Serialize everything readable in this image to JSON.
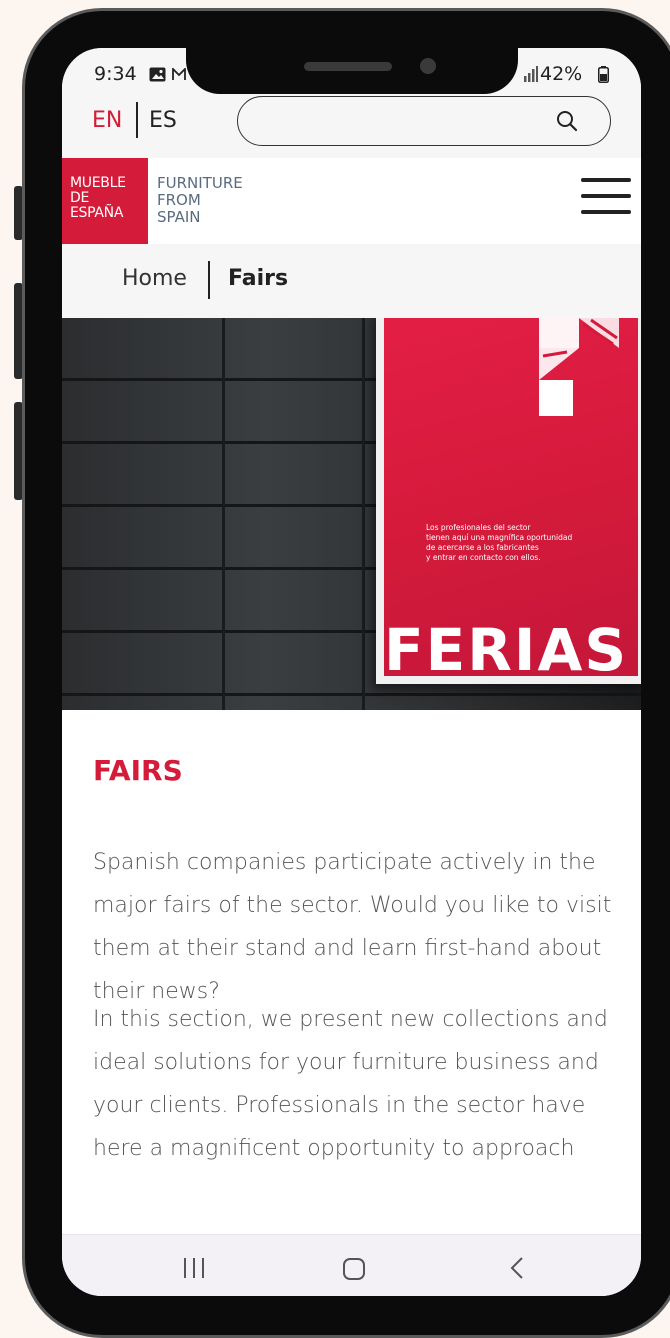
{
  "status_bar": {
    "time": "9:34",
    "battery": "42%",
    "icons": [
      "gallery-icon",
      "mail-icon",
      "signal-icon",
      "battery-icon"
    ]
  },
  "language": {
    "active": "EN",
    "other": "ES"
  },
  "search": {
    "value": "",
    "placeholder": ""
  },
  "header": {
    "logo_lines": [
      "MUEBLE",
      "DE",
      "ESPAÑA"
    ],
    "tagline_lines": [
      "FURNITURE",
      "FROM",
      "SPAIN"
    ],
    "menu_icon": "hamburger-menu-icon"
  },
  "breadcrumb": {
    "home": "Home",
    "current": "Fairs"
  },
  "hero": {
    "poster_text_lines": [
      "Los profesionales del sector",
      "tienen aquí una magnífica oportunidad",
      "de acercarse a los fabricantes",
      "y entrar en contacto con ellos."
    ],
    "poster_word": "FERIAS"
  },
  "content": {
    "title": "FAIRS",
    "paragraph_1": "Spanish companies participate actively in the major fairs of the sector. Would you like to visit them at their stand and learn first-hand about their news?",
    "paragraph_2": "In this section, we present new collections and ideal solutions for your furniture business and your clients. Professionals in the sector have here a magnificent opportunity to approach"
  },
  "nav_bar": {
    "icons": [
      "recents-icon",
      "home-icon",
      "back-icon"
    ]
  },
  "colors": {
    "brand_red": "#d51b3a",
    "text_dark": "#222222",
    "text_body": "#555555",
    "tagline_gray": "#5a6b80",
    "page_background": "#fdf5ef"
  }
}
